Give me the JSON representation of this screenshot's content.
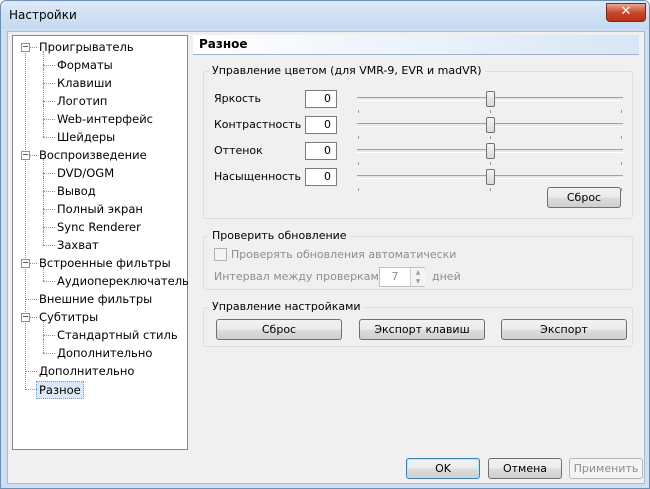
{
  "window": {
    "title": "Настройки",
    "close_glyph": "✕"
  },
  "tree": {
    "items": [
      {
        "label": "Проигрыватель",
        "level": 0,
        "expander": "−"
      },
      {
        "label": "Форматы",
        "level": 1
      },
      {
        "label": "Клавиши",
        "level": 1
      },
      {
        "label": "Логотип",
        "level": 1
      },
      {
        "label": "Web-интерфейс",
        "level": 1
      },
      {
        "label": "Шейдеры",
        "level": 1
      },
      {
        "label": "Воспроизведение",
        "level": 0,
        "expander": "−"
      },
      {
        "label": "DVD/OGM",
        "level": 1
      },
      {
        "label": "Вывод",
        "level": 1
      },
      {
        "label": "Полный экран",
        "level": 1
      },
      {
        "label": "Sync Renderer",
        "level": 1
      },
      {
        "label": "Захват",
        "level": 1
      },
      {
        "label": "Встроенные фильтры",
        "level": 0,
        "expander": "−"
      },
      {
        "label": "Аудиопереключатель",
        "level": 1
      },
      {
        "label": "Внешние фильтры",
        "level": 0
      },
      {
        "label": "Субтитры",
        "level": 0,
        "expander": "−"
      },
      {
        "label": "Стандартный стиль",
        "level": 1
      },
      {
        "label": "Дополнительно",
        "level": 1
      },
      {
        "label": "Дополнительно",
        "level": 0
      },
      {
        "label": "Разное",
        "level": 0,
        "selected": true
      }
    ]
  },
  "pane": {
    "title": "Разное",
    "color": {
      "group_title": "Управление цветом (для VMR-9, EVR и madVR)",
      "sliders": [
        {
          "label": "Яркость",
          "value": "0",
          "position": 0.5
        },
        {
          "label": "Контрастность",
          "value": "0",
          "position": 0.5
        },
        {
          "label": "Оттенок",
          "value": "0",
          "position": 0.5
        },
        {
          "label": "Насыщенность",
          "value": "0",
          "position": 0.5
        }
      ],
      "reset_label": "Сброс"
    },
    "update": {
      "group_title": "Проверить обновление",
      "auto_check_label": "Проверять обновления автоматически",
      "interval_label": "Интервал между проверками:",
      "interval_value": "7",
      "interval_unit": "дней"
    },
    "settings": {
      "group_title": "Управление настройками",
      "reset_label": "Сброс",
      "export_keys_label": "Экспорт клавиш",
      "export_label": "Экспорт"
    }
  },
  "footer": {
    "ok_label": "OK",
    "cancel_label": "Отмена",
    "apply_label": "Применить"
  }
}
